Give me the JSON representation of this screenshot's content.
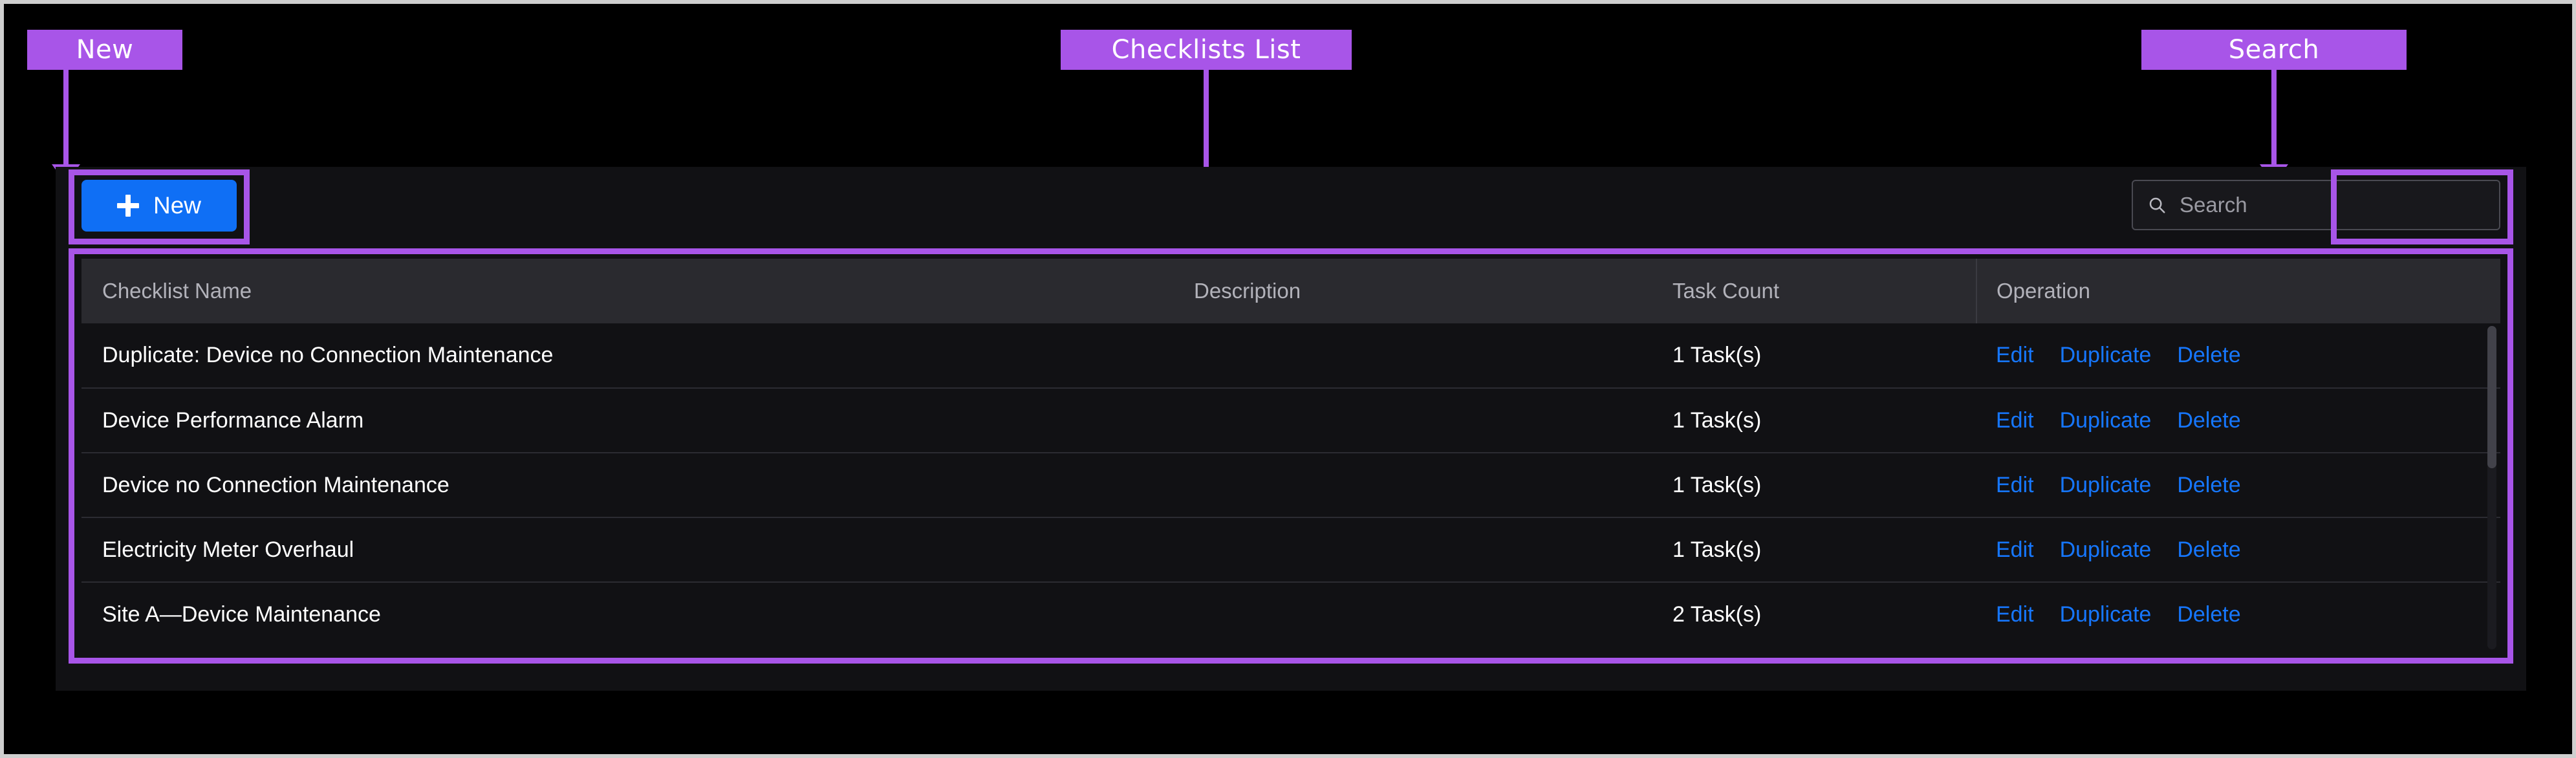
{
  "annotations": [
    {
      "id": "new",
      "label": "New"
    },
    {
      "id": "checklists",
      "label": "Checklists List"
    },
    {
      "id": "search",
      "label": "Search"
    }
  ],
  "toolbar": {
    "new_button_label": "New",
    "new_button_icon": "plus-icon",
    "new_button_color": "#0f6ff5"
  },
  "search": {
    "icon": "search-icon",
    "placeholder": "Search",
    "value": ""
  },
  "table": {
    "columns": [
      {
        "key": "name",
        "label": "Checklist Name"
      },
      {
        "key": "desc",
        "label": "Description"
      },
      {
        "key": "count",
        "label": "Task Count"
      },
      {
        "key": "ops",
        "label": "Operation"
      }
    ],
    "operations": [
      {
        "key": "edit",
        "label": "Edit"
      },
      {
        "key": "duplicate",
        "label": "Duplicate"
      },
      {
        "key": "delete",
        "label": "Delete"
      }
    ],
    "rows": [
      {
        "name": "Duplicate: Device no Connection Maintenance",
        "desc": "",
        "count": "1 Task(s)"
      },
      {
        "name": "Device Performance Alarm",
        "desc": "",
        "count": "1 Task(s)"
      },
      {
        "name": "Device no Connection Maintenance",
        "desc": "",
        "count": "1 Task(s)"
      },
      {
        "name": "Electricity Meter Overhaul",
        "desc": "",
        "count": "1 Task(s)"
      },
      {
        "name": "Site A—Device Maintenance",
        "desc": "",
        "count": "2 Task(s)"
      }
    ]
  },
  "colors": {
    "annotation": "#a855e8",
    "primary_button": "#0f6ff5",
    "link": "#1677ff",
    "page_background": "#111114",
    "header_background": "#2a2a2f"
  }
}
